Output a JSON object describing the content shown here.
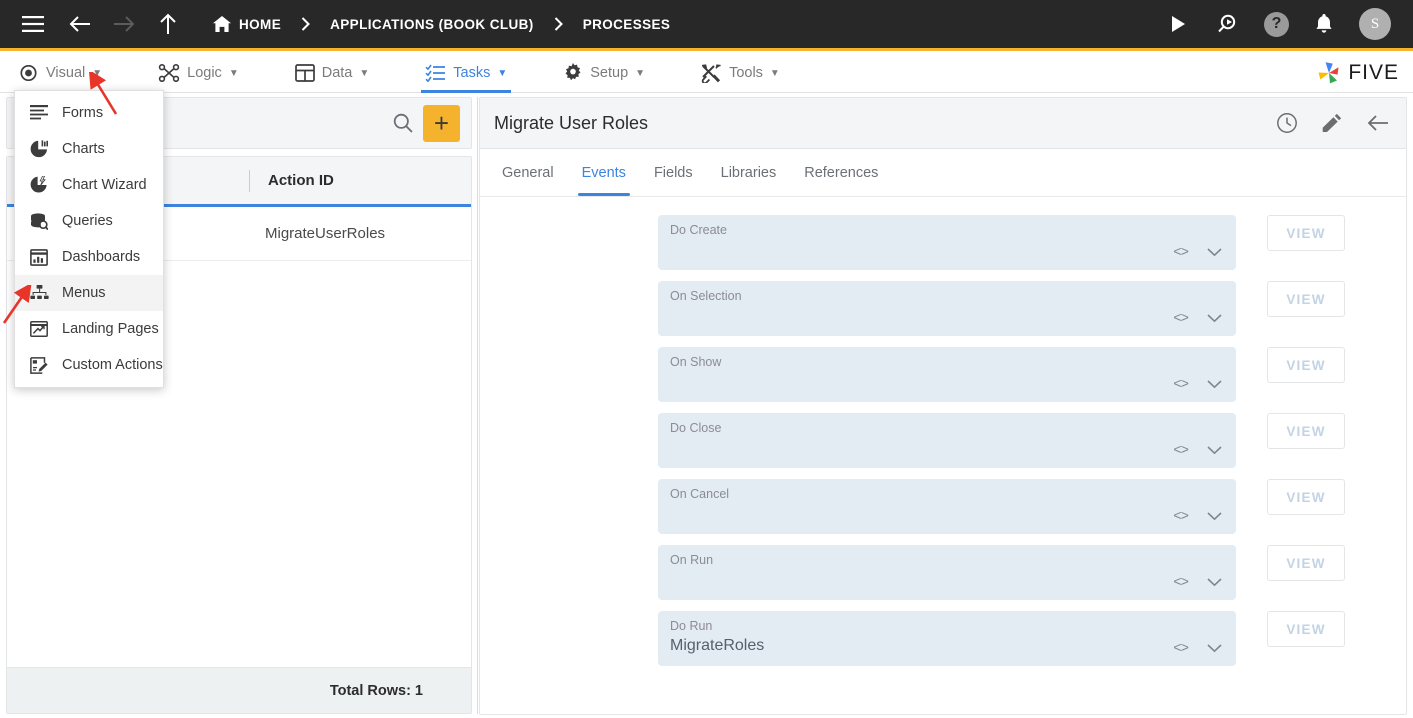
{
  "topbar": {
    "icons": [
      {
        "name": "hamburger-menu-icon",
        "glyph": "menu"
      },
      {
        "name": "back-arrow-icon",
        "glyph": "arrow-left"
      },
      {
        "name": "forward-arrow-icon",
        "glyph": "arrow-right"
      },
      {
        "name": "up-arrow-icon",
        "glyph": "arrow-up"
      }
    ],
    "breadcrumbs": [
      {
        "label": "HOME",
        "icon": "home-icon"
      },
      {
        "label": "APPLICATIONS (BOOK CLUB)",
        "icon": ""
      },
      {
        "label": "PROCESSES",
        "icon": ""
      }
    ],
    "separator": "›",
    "right_icons": [
      {
        "name": "run-play-icon",
        "glyph": "play"
      },
      {
        "name": "search-inspect-icon",
        "glyph": "search-play"
      },
      {
        "name": "help-icon",
        "glyph": "question"
      },
      {
        "name": "notifications-bell-icon",
        "glyph": "bell"
      }
    ],
    "avatar_initial": "S",
    "accent_bar_color": "#f5b32d",
    "background_color": "#282828"
  },
  "menubar": {
    "items": [
      {
        "label": "Visual",
        "icon": "eye-icon",
        "caret": "▼",
        "active": false
      },
      {
        "label": "Logic",
        "icon": "flow-nodes-icon",
        "caret": "▼",
        "active": false
      },
      {
        "label": "Data",
        "icon": "table-grid-icon",
        "caret": "▼",
        "active": false
      },
      {
        "label": "Tasks",
        "icon": "checklist-icon",
        "caret": "▼",
        "active": true
      },
      {
        "label": "Setup",
        "icon": "gear-icon",
        "caret": "▼",
        "active": false
      },
      {
        "label": "Tools",
        "icon": "tools-wrench-icon",
        "caret": "▼",
        "active": false
      }
    ],
    "brand": {
      "name": "five-logo-icon",
      "word": "FIVE"
    },
    "active_color": "#3c84e0"
  },
  "dropdown": {
    "open_for": "Visual",
    "items": [
      {
        "label": "Forms",
        "icon": "forms-lines-icon",
        "hover": false
      },
      {
        "label": "Charts",
        "icon": "pie-chart-icon",
        "hover": false
      },
      {
        "label": "Chart Wizard",
        "icon": "chart-wizard-icon",
        "hover": false
      },
      {
        "label": "Queries",
        "icon": "database-search-icon",
        "hover": false
      },
      {
        "label": "Dashboards",
        "icon": "dashboard-icon",
        "hover": false
      },
      {
        "label": "Menus",
        "icon": "menu-tree-icon",
        "hover": true
      },
      {
        "label": "Landing Pages",
        "icon": "landing-page-icon",
        "hover": false
      },
      {
        "label": "Custom Actions",
        "icon": "custom-action-icon",
        "hover": false
      }
    ]
  },
  "left_panel": {
    "search": {
      "placeholder": "",
      "value": "",
      "icon": "search-icon"
    },
    "add_button": {
      "label": "+",
      "name": "add-record-button",
      "color": "#f5b32d"
    },
    "grid": {
      "columns": [
        "Action ID"
      ],
      "rows": [
        [
          "MigrateUserRoles"
        ]
      ],
      "footer_label": "Total Rows: 1",
      "header_underline_color": "#3c84e0"
    }
  },
  "right_panel": {
    "title": "Migrate User Roles",
    "header_icons": [
      {
        "name": "history-clock-icon",
        "glyph": "clock"
      },
      {
        "name": "edit-pencil-icon",
        "glyph": "pencil"
      },
      {
        "name": "back-arrow-icon",
        "glyph": "arrow-left"
      }
    ],
    "tabs": [
      {
        "label": "General",
        "active": false
      },
      {
        "label": "Events",
        "active": true
      },
      {
        "label": "Fields",
        "active": false
      },
      {
        "label": "Libraries",
        "active": false
      },
      {
        "label": "References",
        "active": false
      }
    ],
    "events": [
      {
        "label": "Do Create",
        "value": "",
        "view_label": "VIEW"
      },
      {
        "label": "On Selection",
        "value": "",
        "view_label": "VIEW"
      },
      {
        "label": "On Show",
        "value": "",
        "view_label": "VIEW"
      },
      {
        "label": "Do Close",
        "value": "",
        "view_label": "VIEW"
      },
      {
        "label": "On Cancel",
        "value": "",
        "view_label": "VIEW"
      },
      {
        "label": "On Run",
        "value": "",
        "view_label": "VIEW"
      },
      {
        "label": "Do Run",
        "value": "MigrateRoles",
        "view_label": "VIEW"
      }
    ],
    "event_controls": {
      "code_icon": "code-brackets-icon",
      "expand_icon": "chevron-down-icon"
    }
  },
  "annotations": {
    "arrows": [
      {
        "name": "red-arrow-pointing-visual-menu",
        "color": "#e8352a"
      },
      {
        "name": "red-arrow-pointing-menus-item",
        "color": "#e8352a"
      }
    ]
  }
}
